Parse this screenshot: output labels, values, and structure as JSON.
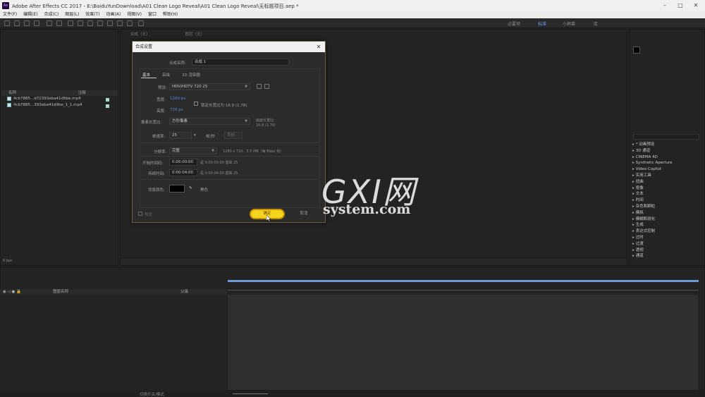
{
  "titlebar": {
    "app_logo": "Ae",
    "title": "Adobe After Effects CC 2017 - E:\\BaiduYunDownload\\A01 Clean Logo Reveal\\A01 Clean Logo Reveal\\无标题项目.aep *"
  },
  "menu": [
    "文件(F)",
    "编辑(E)",
    "合成(C)",
    "图层(L)",
    "效果(T)",
    "动画(A)",
    "视图(V)",
    "窗口",
    "帮助(H)"
  ],
  "workspaces": [
    "必要项",
    "标准",
    "小屏幕",
    "库"
  ],
  "project": {
    "columns": {
      "name": "名称",
      "comment": "注释"
    },
    "items": [
      {
        "name": "4cb7885...d72393eba41d9be.mp4"
      },
      {
        "name": "4cb7885...393eba41d9be_1_1.mp4"
      }
    ],
    "bpc": "8 bpc"
  },
  "comp_panel": {
    "tab_comp": "合成（无）",
    "tab_layer": "图层（无）"
  },
  "effects_list": [
    "* 动画预设",
    "3D 通道",
    "CINEMA 4D",
    "Synthetic Aperture",
    "Video Copilot",
    "实用工具",
    "扭曲",
    "抠像",
    "文本",
    "时间",
    "杂色和颗粒",
    "模拟",
    "模糊和锐化",
    "生成",
    "表达式控制",
    "过时",
    "过渡",
    "透视",
    "通道"
  ],
  "timeline": {
    "col_layer_name": "图层名称",
    "col_parent": "父级",
    "toggle_label": "切换开关/模式"
  },
  "dialog": {
    "title": "合成设置",
    "comp_name_label": "合成名称:",
    "comp_name_value": "合成 1",
    "tabs": [
      "基本",
      "高级",
      "3D 渲染器"
    ],
    "preset_label": "预设:",
    "preset_value": "HDV/HDTV 720 25",
    "width_label": "宽度:",
    "width_value": "1280 px",
    "height_label": "高度:",
    "height_value": "720 px",
    "lock_ratio_label": "锁定长宽比为 16:9 (1.78)",
    "par_label": "像素长宽比:",
    "par_value": "方形像素",
    "frame_aspect_label": "画面长宽比:",
    "frame_aspect_value": "16:9 (1.78)",
    "fps_label": "帧速率:",
    "fps_value": "25",
    "fps_unit": "帧/秒",
    "fps_drop": "丢帧",
    "res_label": "分辨率:",
    "res_value": "完整",
    "res_info": "1280 x 720，3.5 MB（每 8bpc 帧）",
    "start_label": "开始时间码:",
    "start_value": "0:00:00:00",
    "start_note": "是 0:00:00:00  基础 25",
    "dur_label": "持续时间:",
    "dur_value": "0:00:04:00",
    "dur_note": "是 0:00:04:00  基础 25",
    "bg_label": "背景颜色:",
    "bg_color": "#000000",
    "bg_name": "黑色",
    "preview_label": "预览",
    "ok_label": "确定",
    "cancel_label": "取消"
  },
  "watermark": {
    "line1": "GXI网",
    "line2": "system.com"
  }
}
